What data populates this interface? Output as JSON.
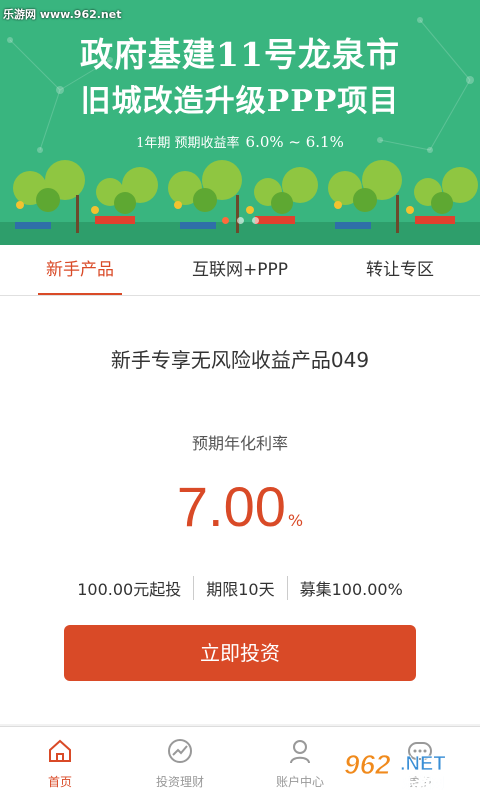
{
  "watermark": {
    "top": "乐游网 www.962.net",
    "bottom_logo": "962.NET",
    "bottom_sub": "乐游网"
  },
  "banner": {
    "title_line1": "政府基建11号龙泉市",
    "title_line2": "旧城改造升级PPP项目",
    "subtitle_prefix": "1年期  预期收益率",
    "rate_range": "6.0%  ~  6.1%",
    "slides": 3,
    "active_slide": 1
  },
  "tabs": [
    {
      "label": "新手产品",
      "active": true
    },
    {
      "label": "互联网+PPP",
      "active": false
    },
    {
      "label": "转让专区",
      "active": false
    }
  ],
  "product": {
    "name": "新手专享无风险收益产品049",
    "rate_label": "预期年化利率",
    "rate_value": "7.00",
    "rate_unit": "%",
    "min_invest": "100.00元起投",
    "term": "期限10天",
    "raised": "募集100.00%",
    "invest_button": "立即投资"
  },
  "nav": [
    {
      "label": "首页",
      "icon": "home-icon",
      "active": true
    },
    {
      "label": "投资理财",
      "icon": "chart-icon",
      "active": false
    },
    {
      "label": "账户中心",
      "icon": "user-icon",
      "active": false
    },
    {
      "label": "更多",
      "icon": "more-icon",
      "active": false
    }
  ],
  "colors": {
    "brand": "#d94a27",
    "banner_green": "#39b57f"
  }
}
